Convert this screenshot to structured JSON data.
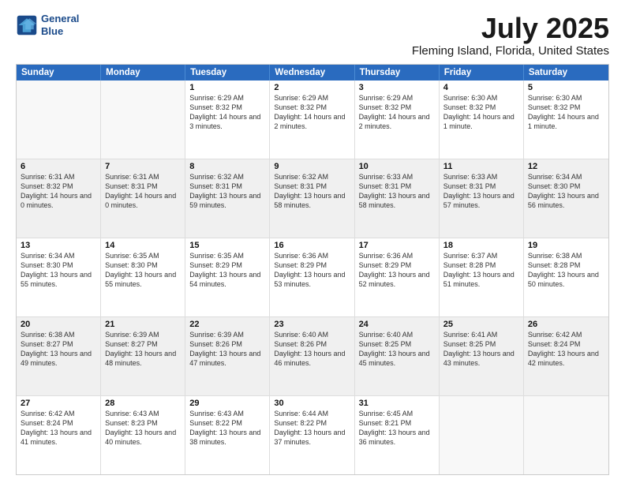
{
  "header": {
    "logo_line1": "General",
    "logo_line2": "Blue",
    "title": "July 2025",
    "subtitle": "Fleming Island, Florida, United States"
  },
  "days_of_week": [
    "Sunday",
    "Monday",
    "Tuesday",
    "Wednesday",
    "Thursday",
    "Friday",
    "Saturday"
  ],
  "weeks": [
    [
      {
        "day": "",
        "empty": true
      },
      {
        "day": "",
        "empty": true
      },
      {
        "day": "1",
        "rise": "6:29 AM",
        "set": "8:32 PM",
        "daylight": "14 hours and 3 minutes."
      },
      {
        "day": "2",
        "rise": "6:29 AM",
        "set": "8:32 PM",
        "daylight": "14 hours and 2 minutes."
      },
      {
        "day": "3",
        "rise": "6:29 AM",
        "set": "8:32 PM",
        "daylight": "14 hours and 2 minutes."
      },
      {
        "day": "4",
        "rise": "6:30 AM",
        "set": "8:32 PM",
        "daylight": "14 hours and 1 minute."
      },
      {
        "day": "5",
        "rise": "6:30 AM",
        "set": "8:32 PM",
        "daylight": "14 hours and 1 minute."
      }
    ],
    [
      {
        "day": "6",
        "rise": "6:31 AM",
        "set": "8:32 PM",
        "daylight": "14 hours and 0 minutes."
      },
      {
        "day": "7",
        "rise": "6:31 AM",
        "set": "8:31 PM",
        "daylight": "14 hours and 0 minutes."
      },
      {
        "day": "8",
        "rise": "6:32 AM",
        "set": "8:31 PM",
        "daylight": "13 hours and 59 minutes."
      },
      {
        "day": "9",
        "rise": "6:32 AM",
        "set": "8:31 PM",
        "daylight": "13 hours and 58 minutes."
      },
      {
        "day": "10",
        "rise": "6:33 AM",
        "set": "8:31 PM",
        "daylight": "13 hours and 58 minutes."
      },
      {
        "day": "11",
        "rise": "6:33 AM",
        "set": "8:31 PM",
        "daylight": "13 hours and 57 minutes."
      },
      {
        "day": "12",
        "rise": "6:34 AM",
        "set": "8:30 PM",
        "daylight": "13 hours and 56 minutes."
      }
    ],
    [
      {
        "day": "13",
        "rise": "6:34 AM",
        "set": "8:30 PM",
        "daylight": "13 hours and 55 minutes."
      },
      {
        "day": "14",
        "rise": "6:35 AM",
        "set": "8:30 PM",
        "daylight": "13 hours and 55 minutes."
      },
      {
        "day": "15",
        "rise": "6:35 AM",
        "set": "8:29 PM",
        "daylight": "13 hours and 54 minutes."
      },
      {
        "day": "16",
        "rise": "6:36 AM",
        "set": "8:29 PM",
        "daylight": "13 hours and 53 minutes."
      },
      {
        "day": "17",
        "rise": "6:36 AM",
        "set": "8:29 PM",
        "daylight": "13 hours and 52 minutes."
      },
      {
        "day": "18",
        "rise": "6:37 AM",
        "set": "8:28 PM",
        "daylight": "13 hours and 51 minutes."
      },
      {
        "day": "19",
        "rise": "6:38 AM",
        "set": "8:28 PM",
        "daylight": "13 hours and 50 minutes."
      }
    ],
    [
      {
        "day": "20",
        "rise": "6:38 AM",
        "set": "8:27 PM",
        "daylight": "13 hours and 49 minutes."
      },
      {
        "day": "21",
        "rise": "6:39 AM",
        "set": "8:27 PM",
        "daylight": "13 hours and 48 minutes."
      },
      {
        "day": "22",
        "rise": "6:39 AM",
        "set": "8:26 PM",
        "daylight": "13 hours and 47 minutes."
      },
      {
        "day": "23",
        "rise": "6:40 AM",
        "set": "8:26 PM",
        "daylight": "13 hours and 46 minutes."
      },
      {
        "day": "24",
        "rise": "6:40 AM",
        "set": "8:25 PM",
        "daylight": "13 hours and 45 minutes."
      },
      {
        "day": "25",
        "rise": "6:41 AM",
        "set": "8:25 PM",
        "daylight": "13 hours and 43 minutes."
      },
      {
        "day": "26",
        "rise": "6:42 AM",
        "set": "8:24 PM",
        "daylight": "13 hours and 42 minutes."
      }
    ],
    [
      {
        "day": "27",
        "rise": "6:42 AM",
        "set": "8:24 PM",
        "daylight": "13 hours and 41 minutes."
      },
      {
        "day": "28",
        "rise": "6:43 AM",
        "set": "8:23 PM",
        "daylight": "13 hours and 40 minutes."
      },
      {
        "day": "29",
        "rise": "6:43 AM",
        "set": "8:22 PM",
        "daylight": "13 hours and 38 minutes."
      },
      {
        "day": "30",
        "rise": "6:44 AM",
        "set": "8:22 PM",
        "daylight": "13 hours and 37 minutes."
      },
      {
        "day": "31",
        "rise": "6:45 AM",
        "set": "8:21 PM",
        "daylight": "13 hours and 36 minutes."
      },
      {
        "day": "",
        "empty": true
      },
      {
        "day": "",
        "empty": true
      }
    ]
  ]
}
